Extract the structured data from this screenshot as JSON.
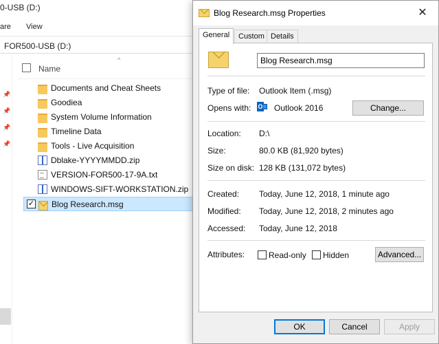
{
  "explorer": {
    "window_title": "0-USB (D:)",
    "ribbon_tabs": [
      "are",
      "View"
    ],
    "address": "FOR500-USB (D:)",
    "column_header": "Name",
    "files": [
      {
        "name": "Documents and Cheat Sheets",
        "icon": "folder-icon",
        "selected": false,
        "checked": false
      },
      {
        "name": "Goodiea",
        "icon": "folder-icon",
        "selected": false,
        "checked": false
      },
      {
        "name": "System Volume Information",
        "icon": "folder-icon",
        "selected": false,
        "checked": false
      },
      {
        "name": "Timeline Data",
        "icon": "folder-icon",
        "selected": false,
        "checked": false
      },
      {
        "name": "Tools - Live Acquisition",
        "icon": "folder-icon",
        "selected": false,
        "checked": false
      },
      {
        "name": "Dblake-YYYYMMDD.zip",
        "icon": "zip-icon",
        "selected": false,
        "checked": false
      },
      {
        "name": "VERSION-FOR500-17-9A.txt",
        "icon": "text-file-icon",
        "selected": false,
        "checked": false
      },
      {
        "name": "WINDOWS-SIFT-WORKSTATION.zip",
        "icon": "zip-icon",
        "selected": false,
        "checked": false
      },
      {
        "name": "Blog Research.msg",
        "icon": "mail-message-icon",
        "selected": true,
        "checked": true
      }
    ]
  },
  "dialog": {
    "title": "Blog Research.msg Properties",
    "close_glyph": "✕",
    "tabs": [
      {
        "label": "General",
        "active": true
      },
      {
        "label": "Custom",
        "active": false
      },
      {
        "label": "Details",
        "active": false
      }
    ],
    "file_name": "Blog Research.msg",
    "type_label": "Type of file:",
    "type_value": "Outlook Item (.msg)",
    "opens_label": "Opens with:",
    "opens_value": "Outlook 2016",
    "opens_icon_glyph": "O",
    "change_button": "Change...",
    "location_label": "Location:",
    "location_value": "D:\\",
    "size_label": "Size:",
    "size_value": "80.0 KB (81,920 bytes)",
    "size_disk_label": "Size on disk:",
    "size_disk_value": "128 KB (131,072 bytes)",
    "created_label": "Created:",
    "created_value": "Today, June 12, 2018, 1 minute ago",
    "modified_label": "Modified:",
    "modified_value": "Today, June 12, 2018, 2 minutes ago",
    "accessed_label": "Accessed:",
    "accessed_value": "Today, June 12, 2018",
    "attributes_label": "Attributes:",
    "readonly_label": "Read-only",
    "hidden_label": "Hidden",
    "advanced_button": "Advanced...",
    "ok_button": "OK",
    "cancel_button": "Cancel",
    "apply_button": "Apply"
  }
}
